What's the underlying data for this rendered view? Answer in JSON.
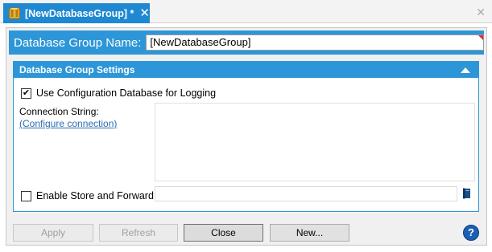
{
  "tab": {
    "title": "[NewDatabaseGroup] *",
    "icon": "database-group-icon"
  },
  "name_bar": {
    "label": "Database Group Name:",
    "value": "[NewDatabaseGroup]"
  },
  "settings": {
    "title": "Database Group Settings",
    "use_config_logging": {
      "label": "Use Configuration Database for Logging",
      "checked": true
    },
    "connection": {
      "label": "Connection String:",
      "link": "(Configure connection)",
      "value": ""
    },
    "store_forward": {
      "label": "Enable Store and Forward:",
      "checked": false,
      "value": ""
    }
  },
  "buttons": {
    "apply": "Apply",
    "refresh": "Refresh",
    "close": "Close",
    "new": "New..."
  },
  "help": {
    "glyph": "?"
  },
  "colors": {
    "accent": "#2d96d8",
    "tab": "#1e88d2",
    "link": "#2c6db3",
    "required_marker": "#e0312c"
  }
}
